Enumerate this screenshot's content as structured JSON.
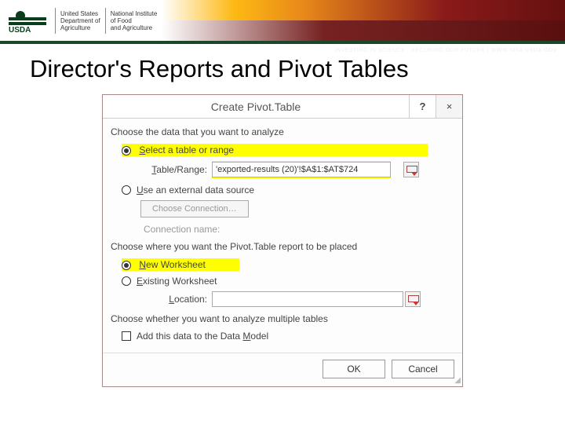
{
  "header": {
    "agency": "USDA",
    "dept1": "United States\nDepartment of\nAgriculture",
    "dept2": "National Institute\nof Food\nand Agriculture",
    "tagline": "INVESTING IN SCIENCE · SECURING OUR FUTURE | WWW.NIFA.USDA.GOV"
  },
  "slide": {
    "title": "Director's Reports and Pivot Tables"
  },
  "dialog": {
    "title": "Create Pivot.Table",
    "help": "?",
    "close": "×",
    "section1": "Choose the data that you want to analyze",
    "opt_select_range": "Select a table or range",
    "table_range_label": "Table/Range:",
    "table_range_value": "'exported-results (20)'!$A$1:$AT$724",
    "opt_external": "Use an external data source",
    "choose_connection": "Choose Connection…",
    "conn_name_label": "Connection name:",
    "section2": "Choose where you want the Pivot.Table report to be placed",
    "opt_new_ws": "New Worksheet",
    "opt_existing_ws": "Existing Worksheet",
    "location_label": "Location:",
    "location_value": "",
    "section3": "Choose whether you want to analyze multiple tables",
    "opt_data_model": "Add this data to the Data Model",
    "ok": "OK",
    "cancel": "Cancel"
  }
}
